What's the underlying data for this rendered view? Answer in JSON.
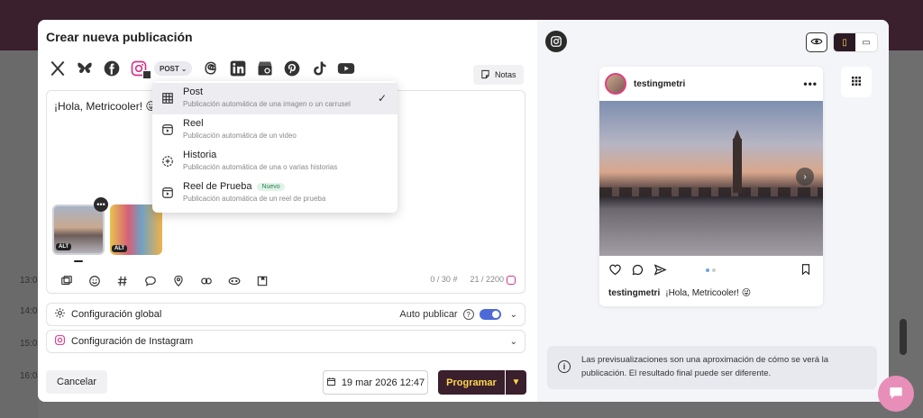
{
  "modal": {
    "title": "Crear nueva publicación",
    "post_type_label": "POST",
    "notes_label": "Notas"
  },
  "networks": [
    {
      "name": "x",
      "icon": "x-icon"
    },
    {
      "name": "bluesky",
      "icon": "bluesky-icon"
    },
    {
      "name": "facebook",
      "icon": "facebook-icon"
    },
    {
      "name": "instagram",
      "icon": "instagram-icon",
      "selected": true
    },
    {
      "name": "threads",
      "icon": "threads-icon"
    },
    {
      "name": "linkedin",
      "icon": "linkedin-icon"
    },
    {
      "name": "google-business",
      "icon": "google-business-icon"
    },
    {
      "name": "pinterest",
      "icon": "pinterest-icon"
    },
    {
      "name": "tiktok",
      "icon": "tiktok-icon"
    },
    {
      "name": "youtube",
      "icon": "youtube-icon"
    }
  ],
  "editor": {
    "text": "¡Hola, Metricooler! 😜",
    "alt_label": "ALT",
    "counter_hashtags": "0 / 30",
    "counter_chars": "21 / 2200"
  },
  "dropdown": {
    "items": [
      {
        "title": "Post",
        "subtitle": "Publicación automática de una imagen o un carrusel",
        "active": true
      },
      {
        "title": "Reel",
        "subtitle": "Publicación automática de un video"
      },
      {
        "title": "Historia",
        "subtitle": "Publicación automática de una o varias historias"
      },
      {
        "title": "Reel de Prueba",
        "subtitle": "Publicación automática de un reel de prueba",
        "badge": "Nuevo"
      }
    ]
  },
  "config": {
    "global_label": "Configuración global",
    "autopublish_label": "Auto publicar",
    "autopublish_on": true,
    "instagram_label": "Configuración de Instagram"
  },
  "footer": {
    "cancel_label": "Cancelar",
    "date_label": "19 mar 2026 12:47",
    "schedule_label": "Programar"
  },
  "preview": {
    "username": "testingmetri",
    "caption": "¡Hola, Metricooler! 😜",
    "info_text": "Las previsualizaciones son una aproximación de cómo se verá la publicación. El resultado final puede ser diferente."
  },
  "background": {
    "times": [
      "13:0",
      "14:0",
      "15:0",
      "16:0"
    ]
  },
  "colors": {
    "brand_dark": "#3a1f2c",
    "brand_yellow": "#ffd84d",
    "toggle_blue": "#4d6bd8",
    "instagram_pink": "#d6338a"
  }
}
